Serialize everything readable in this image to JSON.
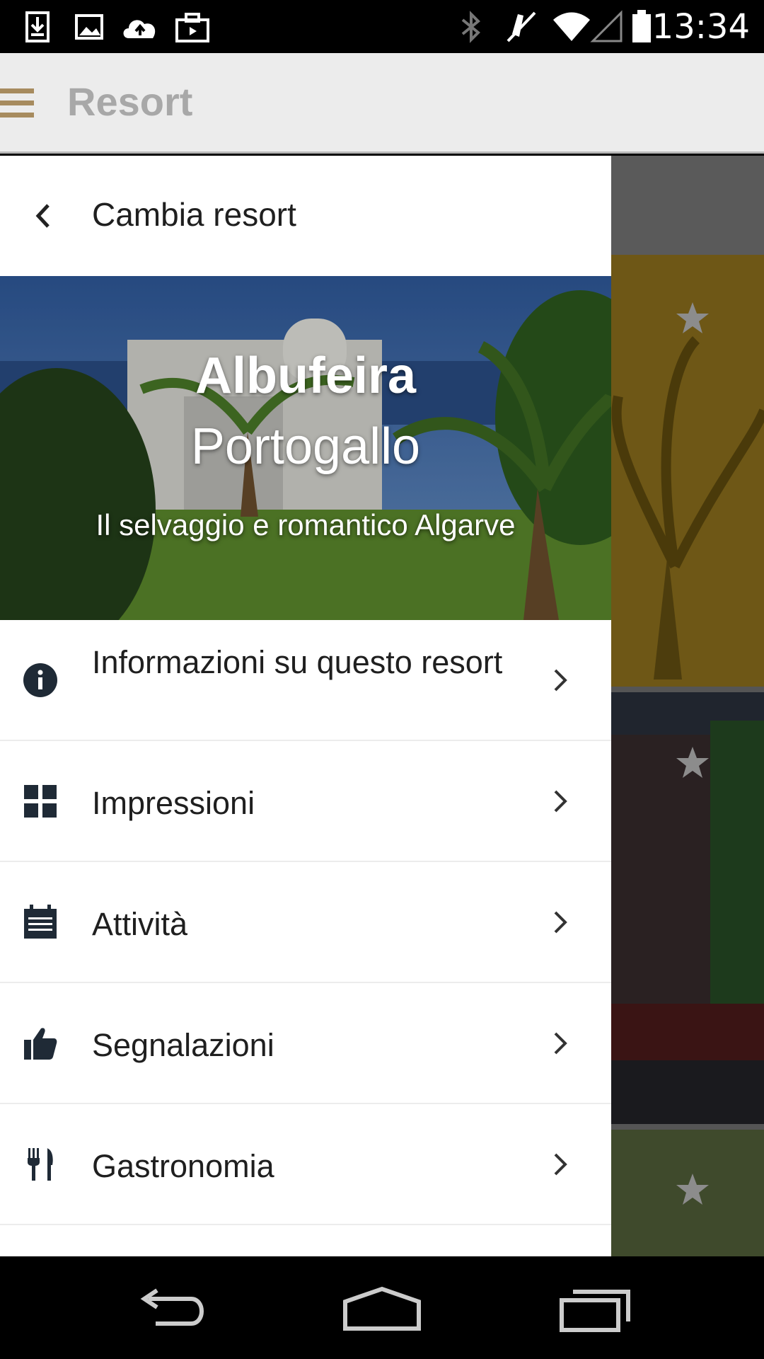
{
  "status_bar": {
    "time": "13:34",
    "icons": [
      "download-icon",
      "image-icon",
      "cloud-upload-icon",
      "briefcase-icon",
      "bluetooth-icon",
      "mute-icon",
      "wifi-icon",
      "signal-icon",
      "battery-icon"
    ]
  },
  "app_bar": {
    "title": "Resort",
    "menu_icon": "hamburger-icon",
    "accent_color": "#a78b5e"
  },
  "drawer": {
    "header": {
      "back_icon": "chevron-left-icon",
      "title": "Cambia resort"
    },
    "hero": {
      "city": "Albufeira",
      "country": "Portogallo",
      "tagline": "Il selvaggio e romantico Algarve"
    },
    "menu": [
      {
        "label": "Informazioni su questo resort",
        "icon": "info-icon"
      },
      {
        "label": "Impressioni",
        "icon": "grid-icon"
      },
      {
        "label": "Attività",
        "icon": "calendar-icon"
      },
      {
        "label": "Segnalazioni",
        "icon": "thumbs-up-icon"
      },
      {
        "label": "Gastronomia",
        "icon": "restaurant-icon"
      }
    ]
  },
  "nav_bar": {
    "buttons": [
      "back-icon",
      "home-icon",
      "recent-apps-icon"
    ]
  }
}
